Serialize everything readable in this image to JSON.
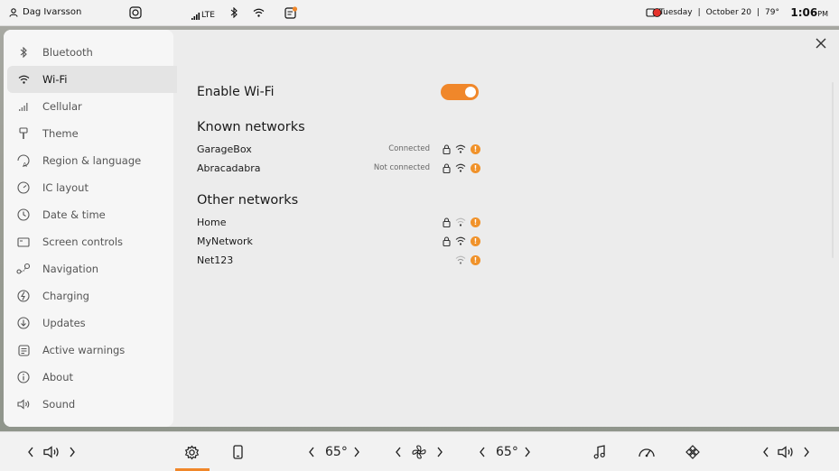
{
  "status_bar": {
    "profile_name": "Dag Ivarsson",
    "signal_label": "LTE",
    "date_day": "Tuesday",
    "date_sep1": "|",
    "date_date": "October 20",
    "date_sep2": "|",
    "outside_temp": "79°",
    "time": "1:06",
    "time_suffix": "PM"
  },
  "sidebar": {
    "items": [
      {
        "label": "Bluetooth",
        "icon": "bluetooth-icon"
      },
      {
        "label": "Wi-Fi",
        "icon": "wifi-icon",
        "active": true
      },
      {
        "label": "Cellular",
        "icon": "cellular-icon"
      },
      {
        "label": "Theme",
        "icon": "brush-icon"
      },
      {
        "label": "Region & language",
        "icon": "language-icon"
      },
      {
        "label": "IC layout",
        "icon": "gauge-icon"
      },
      {
        "label": "Date & time",
        "icon": "clock-icon"
      },
      {
        "label": "Screen controls",
        "icon": "screen-icon"
      },
      {
        "label": "Navigation",
        "icon": "navigation-icon"
      },
      {
        "label": "Charging",
        "icon": "charging-icon"
      },
      {
        "label": "Updates",
        "icon": "updates-icon"
      },
      {
        "label": "Active warnings",
        "icon": "warnings-icon"
      },
      {
        "label": "About",
        "icon": "info-icon"
      },
      {
        "label": "Sound",
        "icon": "speaker-icon"
      }
    ]
  },
  "wifi": {
    "enable_label": "Enable Wi-Fi",
    "enabled": true,
    "known_title": "Known networks",
    "known": [
      {
        "name": "GarageBox",
        "status": "Connected",
        "locked": true
      },
      {
        "name": "Abracadabra",
        "status": "Not connected",
        "locked": true
      }
    ],
    "other_title": "Other networks",
    "other": [
      {
        "name": "Home",
        "status": "",
        "locked": true
      },
      {
        "name": "MyNetwork",
        "status": "",
        "locked": true
      },
      {
        "name": "Net123",
        "status": "",
        "locked": false
      }
    ]
  },
  "dock": {
    "left_temp": "65°",
    "right_temp": "65°"
  },
  "colors": {
    "accent": "#f0872a",
    "panel_bg": "#ececec",
    "sidebar_bg": "#f6f6f6"
  }
}
